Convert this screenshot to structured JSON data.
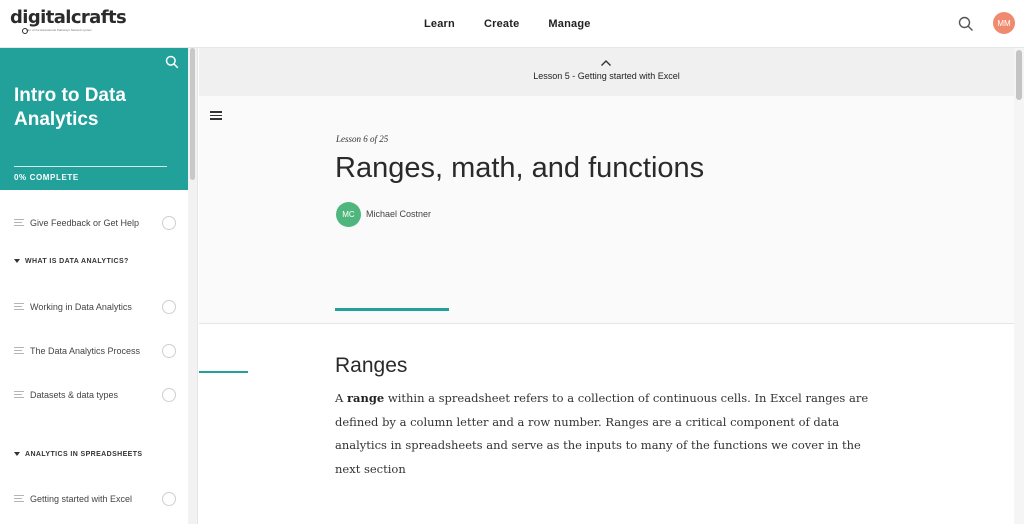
{
  "header": {
    "logo": "digitalcrafts",
    "logo_tagline": "part of the Educational Pathways Network system",
    "nav": [
      "Learn",
      "Create",
      "Manage"
    ],
    "user_initials": "MM"
  },
  "sidebar": {
    "course_title": "Intro to Data Analytics",
    "progress_label": "0% COMPLETE",
    "progress_value": 0,
    "items": [
      {
        "label": "Give Feedback or Get Help"
      },
      {
        "section": "WHAT IS DATA ANALYTICS?"
      },
      {
        "label": "Working in Data Analytics"
      },
      {
        "label": "The Data Analytics Process"
      },
      {
        "label": "Datasets & data types"
      },
      {
        "section": "ANALYTICS IN SPREADSHEETS"
      },
      {
        "label": "Getting started with Excel"
      }
    ]
  },
  "lesson": {
    "prev_lesson_label": "Lesson 5 - Getting started with Excel",
    "lesson_count": "Lesson 6 of 25",
    "title": "Ranges, math, and functions",
    "author_initials": "MC",
    "author_name": "Michael Costner"
  },
  "content": {
    "section_heading": "Ranges",
    "para_prefix": "A ",
    "para_bold": "range",
    "para_rest": " within a spreadsheet refers to a collection of continuous cells. In Excel ranges are defined by a column letter and a row number. Ranges are a critical component of data analytics in spreadsheets and serve as the inputs to many of the functions we cover in the next section"
  },
  "colors": {
    "accent": "#21a19a",
    "author_avatar": "#4fb77e",
    "user_avatar": "#f08a6e"
  }
}
